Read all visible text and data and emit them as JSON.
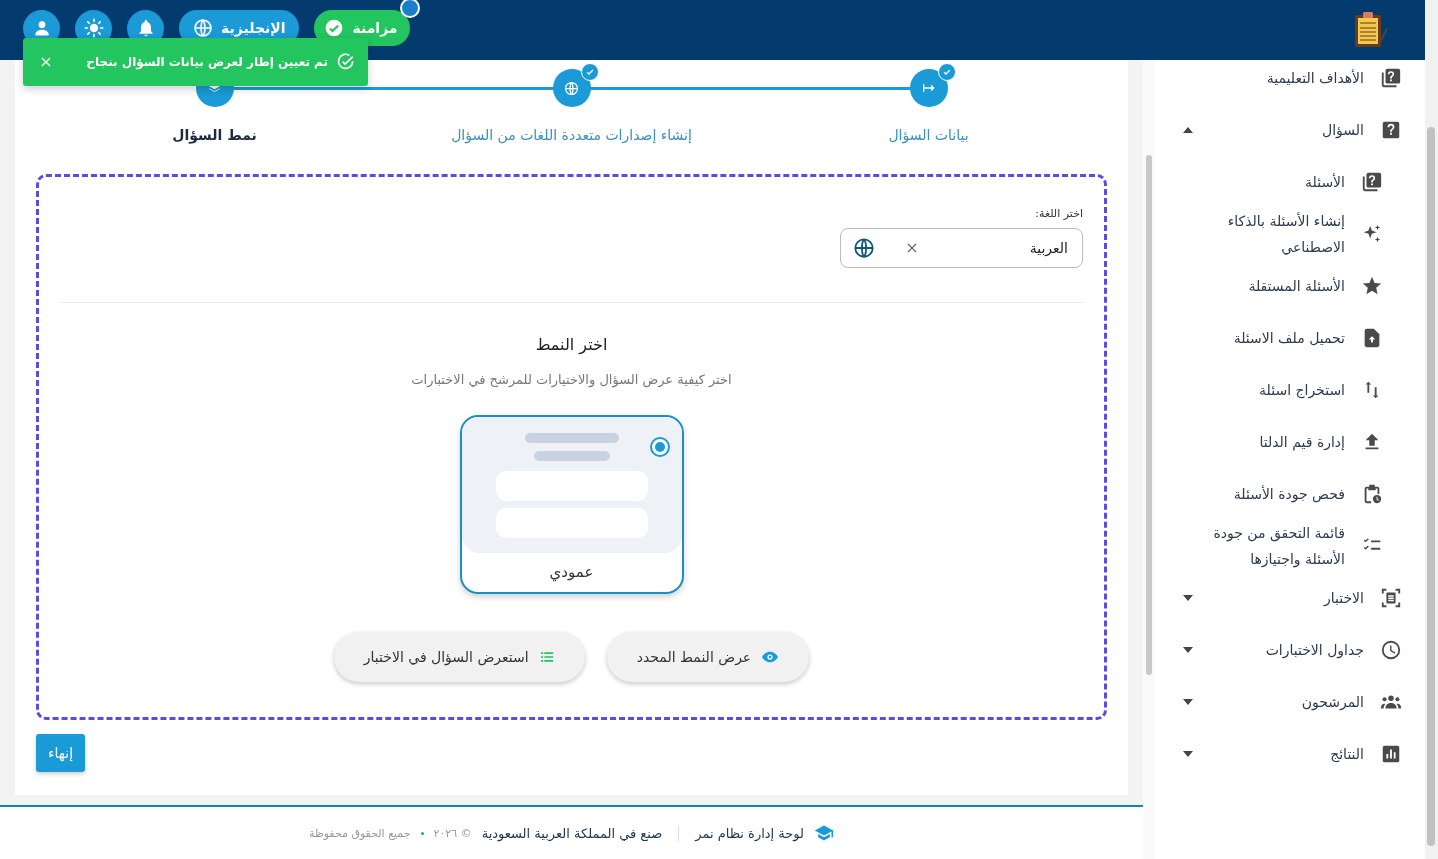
{
  "header": {
    "sync_button": {
      "label": "مزامنة",
      "has_notification": true
    },
    "language_button": {
      "label": "الإنجليزية"
    }
  },
  "toast": {
    "message": "تم تعيين إطار لعرض بيانات السؤال بنجاح"
  },
  "stepper": [
    {
      "label": "بيانات السؤال",
      "completed": true,
      "selected": false
    },
    {
      "label": "إنشاء إصدارات متعددة اللغات من السؤال",
      "completed": true,
      "selected": false
    },
    {
      "label": "نمط السؤال",
      "completed": false,
      "selected": true
    }
  ],
  "language_field": {
    "label": "اختر اللغة:",
    "value": "العربية"
  },
  "pattern_section": {
    "title": "اختر النمط",
    "subtitle": "اختر كيفية عرض السؤال والاختيارات للمرشح في الاختبارات",
    "options": [
      {
        "label": "عمودي",
        "selected": true
      }
    ]
  },
  "actions": [
    {
      "label": "عرض النمط المحدد",
      "kind": "preview"
    },
    {
      "label": "استعرض السؤال في الاختبار",
      "kind": "list"
    }
  ],
  "finish_button": {
    "label": "إنهاء"
  },
  "footer": {
    "brand": "لوحة إدارة نظام نمر",
    "made_in": "صنع في المملكة العربية السعودية",
    "copyright": "© ٢٠٢٦",
    "rights": "جميع الحقوق محفوظة"
  },
  "sidebar": {
    "items": [
      {
        "label": "الأهداف التعليمية",
        "kind": "link"
      },
      {
        "label": "السؤال",
        "kind": "group",
        "expanded": true,
        "children": [
          {
            "label": "الأسئلة"
          },
          {
            "label": "إنشاء الأسئلة بالذكاء الاصطناعي"
          },
          {
            "label": "الأسئلة المستقلة"
          },
          {
            "label": "تحميل ملف الاسئلة"
          },
          {
            "label": "استخراج اسئلة"
          },
          {
            "label": "إدارة قيم الدلتا"
          },
          {
            "label": "فحص جودة الأسئلة"
          },
          {
            "label": "قائمة التحقق من جودة الأسئلة واجتيازها"
          }
        ]
      },
      {
        "label": "الاختبار",
        "kind": "group",
        "expanded": false
      },
      {
        "label": "جداول الاختبارات",
        "kind": "group",
        "expanded": false
      },
      {
        "label": "المرشحون",
        "kind": "group",
        "expanded": false
      },
      {
        "label": "النتائج",
        "kind": "group",
        "expanded": false
      }
    ]
  }
}
